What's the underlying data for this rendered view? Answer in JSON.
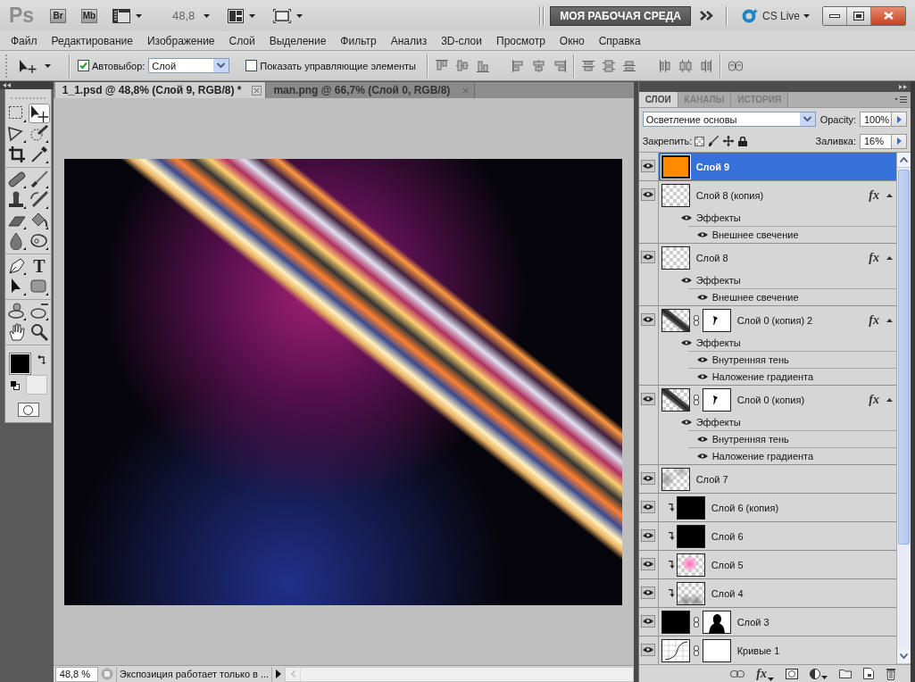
{
  "app_bar": {
    "logo": "Ps",
    "bridge": "Br",
    "mini_bridge": "Mb",
    "zoom": "48,8",
    "workspace": "МОЯ РАБОЧАЯ СРЕДА",
    "cs_live": "CS Live"
  },
  "menu": [
    "Файл",
    "Редактирование",
    "Изображение",
    "Слой",
    "Выделение",
    "Фильтр",
    "Анализ",
    "3D-слои",
    "Просмотр",
    "Окно",
    "Справка"
  ],
  "options_bar": {
    "auto_select": {
      "label": "Автовыбор:",
      "checked": true,
      "value": "Слой"
    },
    "show_controls": {
      "label": "Показать управляющие элементы",
      "checked": false
    }
  },
  "document_tabs": [
    {
      "label": "1_1.psd @ 48,8% (Слой 9, RGB/8) *",
      "selected": true
    },
    {
      "label": "man.png @ 66,7% (Слой 0, RGB/8)",
      "selected": false
    }
  ],
  "tool_groups": [
    [
      {
        "kind": "marquee",
        "selected": false
      },
      {
        "kind": "move",
        "selected": true
      },
      {
        "kind": "lasso",
        "selected": false
      },
      {
        "kind": "quickselect",
        "selected": false
      },
      {
        "kind": "crop",
        "selected": false
      },
      {
        "kind": "eyedropper",
        "selected": false
      }
    ],
    [
      {
        "kind": "healing",
        "selected": false
      },
      {
        "kind": "brush",
        "selected": false
      },
      {
        "kind": "stamp",
        "selected": false
      },
      {
        "kind": "historybrush",
        "selected": false
      },
      {
        "kind": "eraser",
        "selected": false
      },
      {
        "kind": "bucket",
        "selected": false
      },
      {
        "kind": "blur",
        "selected": false
      },
      {
        "kind": "dodge",
        "selected": false
      }
    ],
    [
      {
        "kind": "pen",
        "selected": false
      },
      {
        "kind": "type",
        "glyph": "T",
        "selected": false
      },
      {
        "kind": "pathselect",
        "selected": false
      },
      {
        "kind": "shape",
        "selected": false
      }
    ],
    [
      {
        "kind": "rotate3d",
        "selected": false
      },
      {
        "kind": "camera3d",
        "selected": false
      },
      {
        "kind": "hand",
        "selected": false
      },
      {
        "kind": "zoom",
        "selected": false
      }
    ]
  ],
  "swatches": [
    {
      "kind": "foreground",
      "color": "#000000"
    },
    {
      "kind": "background",
      "color": "#ececec"
    }
  ],
  "status_bar": {
    "zoom": "48,8 %",
    "info": "Экспозиция работает только в ..."
  },
  "layers_panel": {
    "tabs": [
      {
        "label": "СЛОИ",
        "selected": true
      },
      {
        "label": "КАНАЛЫ",
        "selected": false
      },
      {
        "label": "ИСТОРИЯ",
        "selected": false
      }
    ],
    "blend_mode": "Осветление основы",
    "opacity_label": "Opacity:",
    "opacity": "100%",
    "lock_label": "Закрепить:",
    "fill_label": "Заливка:",
    "fill": "16%",
    "layers": [
      {
        "name": "Слой 9",
        "visible": true,
        "selected": true,
        "clipped": false,
        "thumbnail": {
          "kind": "fill"
        }
      },
      {
        "name": "Слой 8 (копия)",
        "visible": true,
        "selected": false,
        "clipped": false,
        "thumbnail": {
          "kind": "transparent"
        },
        "fx": "fx",
        "expanded": true,
        "effects": [
          {
            "name": "Эффекты",
            "visible": true,
            "children": [
              {
                "name": "Внешнее свечение",
                "visible": true
              }
            ]
          }
        ]
      },
      {
        "name": "Слой 8",
        "visible": true,
        "selected": false,
        "clipped": false,
        "thumbnail": {
          "kind": "transparent"
        },
        "fx": "fx",
        "expanded": true,
        "effects": [
          {
            "name": "Эффекты",
            "visible": true,
            "children": [
              {
                "name": "Внешнее свечение",
                "visible": true
              }
            ]
          }
        ]
      },
      {
        "name": "Слой 0 (копия) 2",
        "visible": true,
        "selected": false,
        "clipped": false,
        "thumbnail": {
          "kind": "stripe"
        },
        "mask": {
          "kind": "brush"
        },
        "fx": "fx",
        "expanded": true,
        "effects": [
          {
            "name": "Эффекты",
            "visible": true,
            "children": [
              {
                "name": "Внутренняя тень",
                "visible": true
              },
              {
                "name": "Наложение градиента",
                "visible": true
              }
            ]
          }
        ]
      },
      {
        "name": "Слой 0 (копия)",
        "visible": true,
        "selected": false,
        "clipped": false,
        "thumbnail": {
          "kind": "stripe"
        },
        "mask": {
          "kind": "brush"
        },
        "fx": "fx",
        "expanded": true,
        "effects": [
          {
            "name": "Эффекты",
            "visible": true,
            "children": [
              {
                "name": "Внутренняя тень",
                "visible": true
              },
              {
                "name": "Наложение градиента",
                "visible": true
              }
            ]
          }
        ]
      },
      {
        "name": "Слой 7",
        "visible": true,
        "selected": false,
        "clipped": false,
        "thumbnail": {
          "kind": "smudge"
        }
      },
      {
        "name": "Слой 6 (копия)",
        "visible": true,
        "selected": false,
        "clipped": true,
        "thumbnail": {
          "kind": "black"
        }
      },
      {
        "name": "Слой 6",
        "visible": true,
        "selected": false,
        "clipped": true,
        "thumbnail": {
          "kind": "black"
        }
      },
      {
        "name": "Слой 5",
        "visible": true,
        "selected": false,
        "clipped": true,
        "thumbnail": {
          "kind": "glow"
        }
      },
      {
        "name": "Слой 4",
        "visible": true,
        "selected": false,
        "clipped": true,
        "thumbnail": {
          "kind": "hands"
        }
      },
      {
        "name": "Слой 3",
        "visible": true,
        "selected": false,
        "clipped": false,
        "thumbnail": {
          "kind": "black"
        },
        "mask": {
          "kind": "silhouette"
        }
      },
      {
        "name": "Кривые 1",
        "visible": true,
        "selected": false,
        "clipped": false,
        "thumbnail": {
          "kind": "curves"
        },
        "mask": {
          "kind": "white"
        }
      }
    ],
    "footer": {
      "fx": "fx"
    }
  }
}
